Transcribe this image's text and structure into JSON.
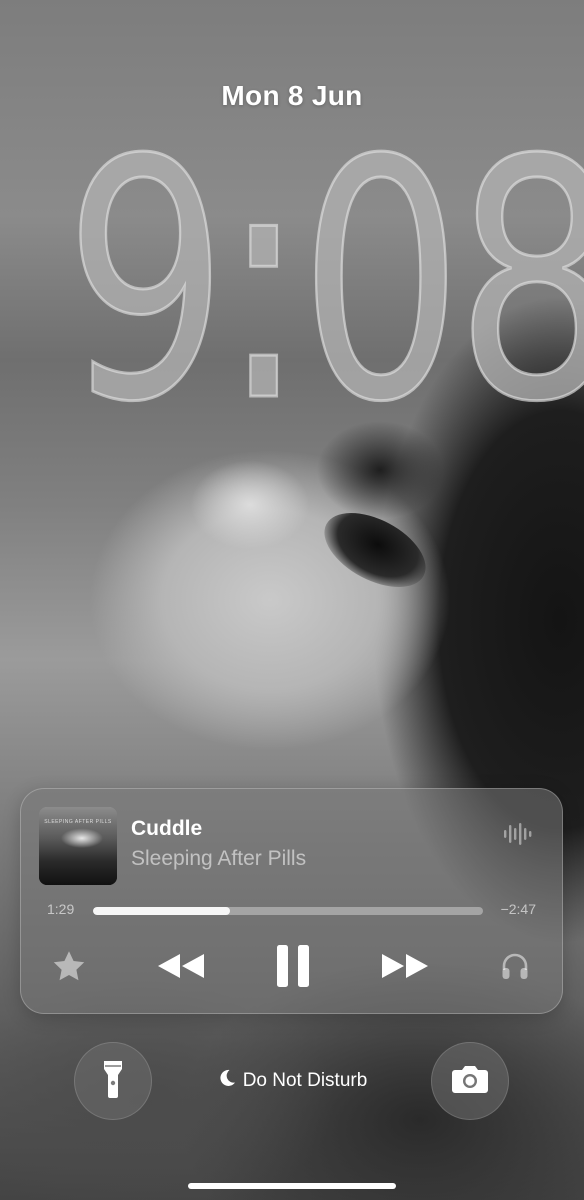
{
  "lockscreen": {
    "date": "Mon 8 Jun",
    "time": "9:08"
  },
  "now_playing": {
    "artwork_text": "SLEEPING AFTER PILLS",
    "title": "Cuddle",
    "artist": "Sleeping After Pills",
    "elapsed": "1:29",
    "remaining": "−2:47",
    "progress": 0.35,
    "icons": {
      "waveform": "waveform-icon",
      "favorite": "star-icon",
      "previous": "backward-icon",
      "play_pause": "pause-icon",
      "next": "forward-icon",
      "output": "headphones-icon"
    }
  },
  "bottom_bar": {
    "focus_label": "Do Not Disturb",
    "focus_icon": "moon-icon",
    "left_button_icon": "flashlight-icon",
    "right_button_icon": "camera-icon"
  },
  "colors": {
    "text_primary": "#ffffff",
    "text_secondary": "rgba(255,255,255,0.55)",
    "widget_bg": "rgba(120,120,120,0.55)"
  }
}
